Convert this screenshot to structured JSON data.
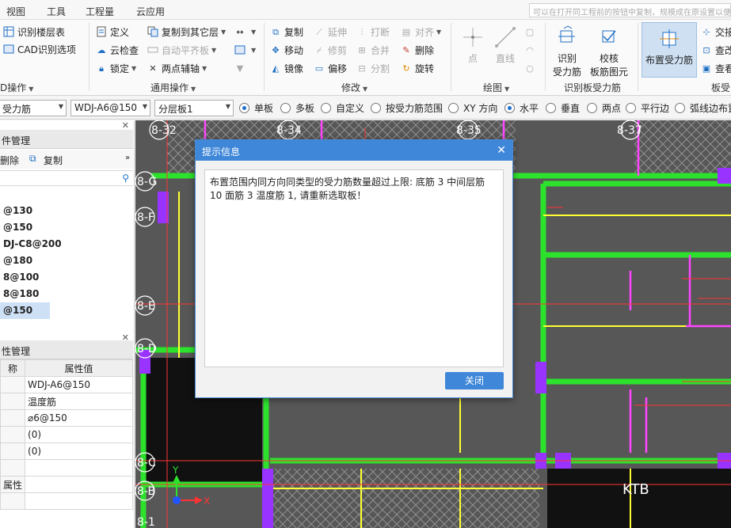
{
  "menu": [
    "视图",
    "工具",
    "工程量",
    "云应用"
  ],
  "top_note": "可以在打开同工程前的按钮中复制，规模成在原设置以便原设置以后……",
  "ribbon": {
    "cad_group": {
      "btn_floor": "识别楼层表",
      "btn_options": "CAD识别选项",
      "label": "D操作"
    },
    "general_group": {
      "define": "定义",
      "copy_to_other": "复制到其它层",
      "cloud_check": "云检查",
      "auto_align": "自动平齐板",
      "lock": "锁定",
      "two_point_aux": "两点辅轴",
      "label": "通用操作"
    },
    "modify_group": {
      "copy": "复制",
      "extend": "延伸",
      "break": "打断",
      "align": "对齐",
      "move": "移动",
      "trim": "修剪",
      "merge": "合并",
      "delete": "删除",
      "mirror": "镜像",
      "offset": "偏移",
      "split": "分割",
      "rotate": "旋转",
      "label": "修改"
    },
    "draw_group": {
      "point": "点",
      "line": "直线",
      "label": "绘图"
    },
    "recognize_group": {
      "recognize_rebar_1": "识别",
      "recognize_rebar_2": "受力筋",
      "check_rebar_1": "校核",
      "check_rebar_2": "板筋图元",
      "label": "识别板受力筋"
    },
    "place_rebar": "布置受力筋",
    "extra": {
      "cross": "交接",
      "query": "查改",
      "view": "查看",
      "label": "板受"
    }
  },
  "options": {
    "combo1": "受力筋",
    "combo2": "WDJ-A6@150",
    "combo3": "分层板1",
    "radios": [
      {
        "label": "单板",
        "checked": true
      },
      {
        "label": "多板",
        "checked": false
      },
      {
        "label": "自定义",
        "checked": false
      },
      {
        "label": "按受力筋范围",
        "checked": false
      },
      {
        "label": "XY 方向",
        "checked": false
      },
      {
        "label": "水平",
        "checked": true
      },
      {
        "label": "垂直",
        "checked": false
      },
      {
        "label": "两点",
        "checked": false
      },
      {
        "label": "平行边",
        "checked": false
      },
      {
        "label": "弧线边布置",
        "checked": false
      }
    ]
  },
  "left_panel": {
    "list_title": "件管理",
    "delete": "删除",
    "copy": "复制",
    "items": [
      "@130",
      "@150",
      "DJ-C8@200",
      "@180",
      "8@100",
      "8@180",
      "@150"
    ],
    "props_title": "性管理",
    "col_name": "称",
    "col_value": "属性值",
    "rows": [
      {
        "k": "",
        "v": "WDJ-A6@150"
      },
      {
        "k": "",
        "v": "温度筋"
      },
      {
        "k": "",
        "v": "⌀6@150"
      },
      {
        "k": "",
        "v": "(0)"
      },
      {
        "k": "",
        "v": "(0)"
      },
      {
        "k": "",
        "v": ""
      },
      {
        "k": "属性",
        "v": ""
      },
      {
        "k": "",
        "v": ""
      }
    ]
  },
  "canvas": {
    "axis_labels": [
      "8-32",
      "8-34",
      "8-35",
      "8-37",
      "8-G",
      "8-F",
      "8-E",
      "8-D",
      "8-C",
      "8-B",
      "8-1"
    ],
    "slab_label": "KTB",
    "axis_x": "X",
    "axis_y": "Y"
  },
  "dialog": {
    "title": "提示信息",
    "message": "布置范围内同方向同类型的受力筋数量超过上限: 底筋 3 中间层筋 10 面筋 3 温度筋 1, 请重新选取板！",
    "close_button": "关闭"
  },
  "colors": {
    "dialog_accent": "#3f87d8",
    "wall": "#2ce22c",
    "beam": "#ff44ff",
    "axis": "#ff3333",
    "rebar": "#ffff33"
  }
}
